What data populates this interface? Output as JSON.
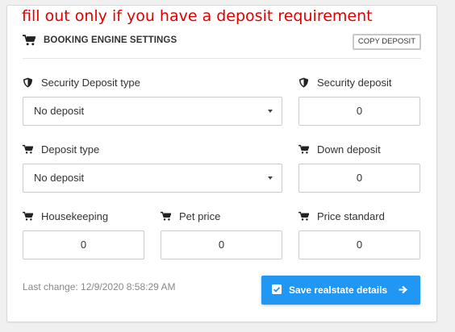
{
  "annotation": "fill out only if you have a deposit requirement",
  "header": {
    "title": "BOOKING ENGINE SETTINGS",
    "copy_label": "COPY DEPOSIT"
  },
  "fields": {
    "security_deposit_type": {
      "label": "Security Deposit type",
      "value": "No deposit",
      "icon": "shield-icon"
    },
    "security_deposit": {
      "label": "Security deposit",
      "value": "0",
      "icon": "shield-icon"
    },
    "deposit_type": {
      "label": "Deposit type",
      "value": "No deposit",
      "icon": "cart-icon"
    },
    "down_deposit": {
      "label": "Down deposit",
      "value": "0",
      "icon": "cart-icon"
    },
    "housekeeping": {
      "label": "Housekeeping",
      "value": "0",
      "icon": "cart-icon"
    },
    "pet_price": {
      "label": "Pet price",
      "value": "0",
      "icon": "cart-icon"
    },
    "price_standard": {
      "label": "Price standard",
      "value": "0",
      "icon": "cart-icon"
    }
  },
  "footer": {
    "last_change": "Last change: 12/9/2020 8:58:29 AM",
    "save_label": "Save realstate details"
  },
  "colors": {
    "accent": "#2196f3",
    "annotation": "#e00000"
  }
}
